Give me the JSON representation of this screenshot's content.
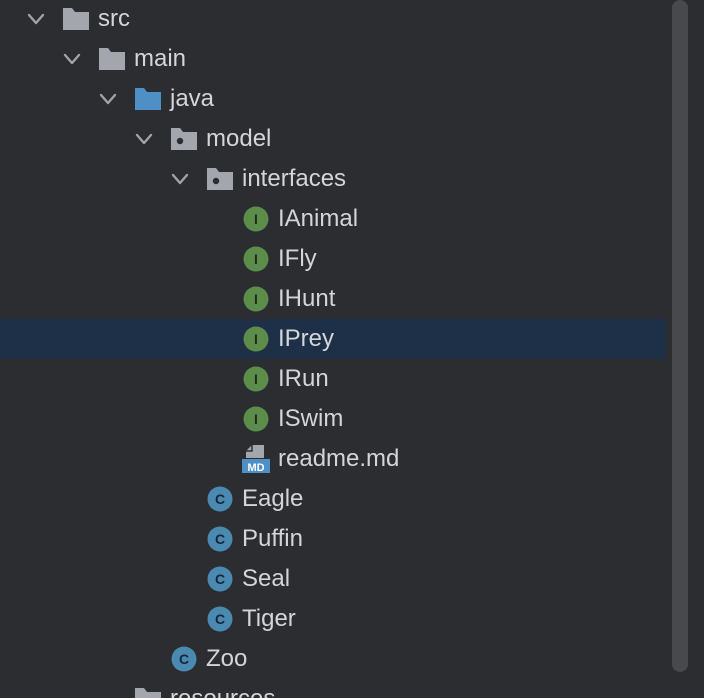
{
  "project_tree": {
    "items": [
      {
        "label": "src",
        "icon": "folder-icon",
        "expanded": true
      },
      {
        "label": "main",
        "icon": "folder-icon",
        "expanded": true
      },
      {
        "label": "java",
        "icon": "source-folder-icon",
        "expanded": true
      },
      {
        "label": "model",
        "icon": "package-icon",
        "expanded": true
      },
      {
        "label": "interfaces",
        "icon": "package-icon",
        "expanded": true
      },
      {
        "label": "IAnimal",
        "icon": "interface-icon",
        "badge": "I"
      },
      {
        "label": "IFly",
        "icon": "interface-icon",
        "badge": "I"
      },
      {
        "label": "IHunt",
        "icon": "interface-icon",
        "badge": "I"
      },
      {
        "label": "IPrey",
        "icon": "interface-icon",
        "badge": "I",
        "selected": true
      },
      {
        "label": "IRun",
        "icon": "interface-icon",
        "badge": "I"
      },
      {
        "label": "ISwim",
        "icon": "interface-icon",
        "badge": "I"
      },
      {
        "label": "readme.md",
        "icon": "markdown-file-icon",
        "badge": "MD"
      },
      {
        "label": "Eagle",
        "icon": "class-icon",
        "badge": "C"
      },
      {
        "label": "Puffin",
        "icon": "class-icon",
        "badge": "C"
      },
      {
        "label": "Seal",
        "icon": "class-icon",
        "badge": "C"
      },
      {
        "label": "Tiger",
        "icon": "class-icon",
        "badge": "C"
      },
      {
        "label": "Zoo",
        "icon": "class-icon",
        "badge": "C"
      },
      {
        "label": "resources",
        "icon": "folder-icon",
        "partially_visible": true
      }
    ]
  },
  "colors": {
    "background": "#2b2d30",
    "selection": "#1e3048",
    "text": "#d3d5d9",
    "folder": "#a3a6ad",
    "source_folder": "#4e8fc6",
    "interface_badge": "#5c8d4a",
    "class_badge": "#4a8ab0"
  }
}
